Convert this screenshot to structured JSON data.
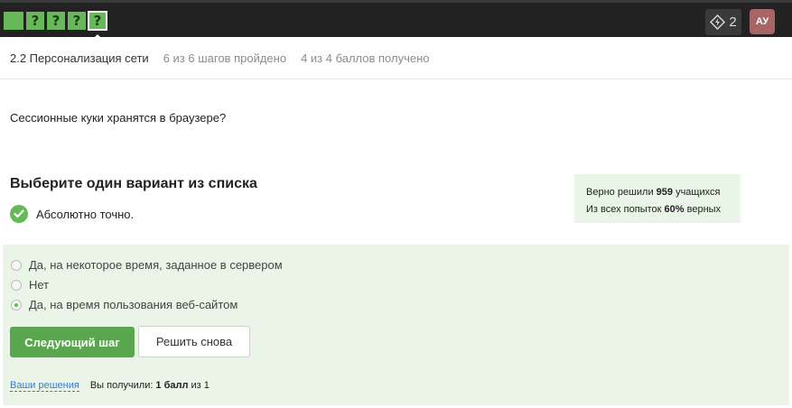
{
  "topbar": {
    "steps": [
      {
        "label": ""
      },
      {
        "label": "?"
      },
      {
        "label": "?"
      },
      {
        "label": "?"
      },
      {
        "label": "?"
      }
    ],
    "energy_count": "2",
    "avatar_initials": "АУ"
  },
  "lesson": {
    "title": "2.2 Персонализация сети",
    "progress": "6 из 6 шагов пройдено",
    "score": "4 из 4 баллов  получено"
  },
  "question": "Сессионные куки хранятся в браузере?",
  "quiz": {
    "title": "Выберите один вариант из списка",
    "feedback": "Абсолютно точно.",
    "stats": {
      "line1_prefix": "Верно решили",
      "line1_value": "959",
      "line1_suffix": "учащихся",
      "line2_prefix": "Из всех попыток",
      "line2_value": "60%",
      "line2_suffix": "верных"
    },
    "options": [
      {
        "label": "Да, на некоторое время, заданное в сервером",
        "selected": false
      },
      {
        "label": "Нет",
        "selected": false
      },
      {
        "label": "Да, на время пользования веб-сайтом",
        "selected": true
      }
    ],
    "next_button": "Следующий шаг",
    "retry_button": "Решить снова",
    "solutions_link": "Ваши решения",
    "result_prefix": "Вы получили:",
    "result_value": "1 балл",
    "result_suffix": "из 1"
  },
  "colors": {
    "accent_green": "#66b858",
    "topbar_bg": "#222222",
    "answers_bg": "#eaf5e7",
    "link_blue": "#3a7bc8",
    "avatar_bg": "#a86565"
  }
}
